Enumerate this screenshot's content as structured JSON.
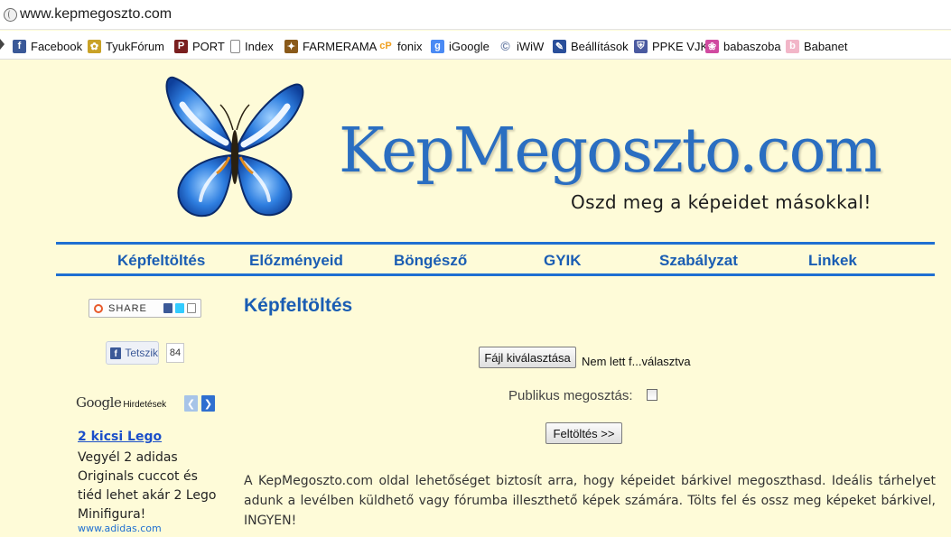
{
  "browser": {
    "url": "www.kepmegoszto.com",
    "bookmarks": [
      {
        "label": "Facebook",
        "icon": "facebook-icon",
        "color": "#3b5998",
        "glyph": "f"
      },
      {
        "label": "TyukFórum",
        "icon": "chicken-icon",
        "color": "#c9a227",
        "glyph": "✿"
      },
      {
        "label": "PORT",
        "icon": "port-icon",
        "color": "#7a1f1f",
        "glyph": "P"
      },
      {
        "label": "Index",
        "icon": "page-icon",
        "color": "#ffffff",
        "glyph": ""
      },
      {
        "label": "FARMERAMA",
        "icon": "farmerama-icon",
        "color": "#8a5a1a",
        "glyph": "✦"
      },
      {
        "label": "fonix",
        "icon": "fonix-icon",
        "color": "#f0a020",
        "glyph": "cP"
      },
      {
        "label": "iGoogle",
        "icon": "google-icon",
        "color": "#4a8af4",
        "glyph": "g"
      },
      {
        "label": "iWiW",
        "icon": "iwiw-icon",
        "color": "#6a7fa6",
        "glyph": "©"
      },
      {
        "label": "Beállítások",
        "icon": "wrench-icon",
        "color": "#2a4f9a",
        "glyph": "✎"
      },
      {
        "label": "PPKE VJK",
        "icon": "ppke-icon",
        "color": "#4a5aa0",
        "glyph": "⛨"
      },
      {
        "label": "babaszoba",
        "icon": "babaszoba-icon",
        "color": "#d04aa0",
        "glyph": "❀"
      },
      {
        "label": "Babanet",
        "icon": "babanet-icon",
        "color": "#f2b6c8",
        "glyph": "b"
      }
    ]
  },
  "header": {
    "title": "KepMegoszto.com",
    "tagline": "Oszd meg a képeidet másokkal!"
  },
  "nav": {
    "items": [
      "Képfeltöltés",
      "Előzményeid",
      "Böngésző",
      "GYIK",
      "Szabályzat",
      "Linkek"
    ]
  },
  "social": {
    "share_label": "SHARE",
    "like_label": "Tetszik",
    "like_count": "84"
  },
  "ads": {
    "google_logo": "Google",
    "header": "Hirdetések",
    "ad_title": "2 kicsi Lego",
    "ad_body": "Vegyél 2 adidas Originals cuccot és tiéd lehet akár 2 Lego Minifigura!",
    "ad_url": "www.adidas.com"
  },
  "main": {
    "title": "Képfeltöltés",
    "file_button": "Fájl kiválasztása",
    "file_status": "Nem lett f...választva",
    "public_label": "Publikus megosztás:",
    "public_checked": false,
    "upload_button": "Feltöltés >>",
    "description": "A KepMegoszto.com oldal lehetőséget biztosít arra, hogy képeidet bárkivel megoszthasd. Ideális tárhelyet adunk a levélben küldhető vagy fórumba illeszthető képek számára. Tölts fel és ossz meg képeket bárkivel, INGYEN!"
  },
  "colors": {
    "background": "#fefbd8",
    "accent_blue": "#1f6fd1",
    "title_blue": "#2a6ec1",
    "link_blue": "#1a5db3"
  }
}
